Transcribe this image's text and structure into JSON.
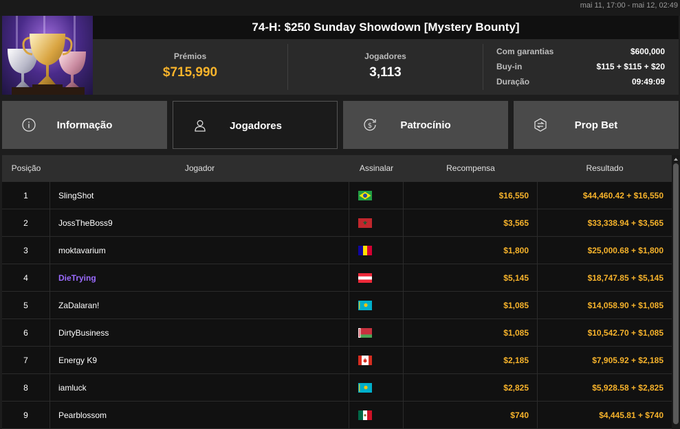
{
  "header": {
    "date_range": "mai 11, 17:00 - mai 12, 02:49",
    "title": "74-H: $250 Sunday Showdown [Mystery Bounty]"
  },
  "stats": {
    "prizes_label": "Prémios",
    "prizes_value": "$715,990",
    "players_label": "Jogadores",
    "players_value": "3,113",
    "details": [
      {
        "label": "Com garantias",
        "value": "$600,000"
      },
      {
        "label": "Buy-in",
        "value": "$115 + $115 + $20"
      },
      {
        "label": "Duração",
        "value": "09:49:09"
      }
    ]
  },
  "tabs": [
    {
      "label": "Informação",
      "icon": "info-icon",
      "active": false
    },
    {
      "label": "Jogadores",
      "icon": "user-icon",
      "active": true
    },
    {
      "label": "Patrocínio",
      "icon": "dollar-icon",
      "active": false
    },
    {
      "label": "Prop Bet",
      "icon": "prop-bet-icon",
      "active": false
    }
  ],
  "table": {
    "columns": [
      "Posição",
      "Jogador",
      "Assinalar",
      "Recompensa",
      "Resultado"
    ],
    "rows": [
      {
        "pos": "1",
        "player": "SlingShot",
        "flag": "brazil-flag",
        "bounty": "$16,550",
        "result": "$44,460.42 + $16,550",
        "highlight": false
      },
      {
        "pos": "2",
        "player": "JossTheBoss9",
        "flag": "morocco-flag",
        "bounty": "$3,565",
        "result": "$33,338.94 + $3,565",
        "highlight": false
      },
      {
        "pos": "3",
        "player": "moktavarium",
        "flag": "andorra-flag",
        "bounty": "$1,800",
        "result": "$25,000.68 + $1,800",
        "highlight": false
      },
      {
        "pos": "4",
        "player": "DieTrying",
        "flag": "austria-flag",
        "bounty": "$5,145",
        "result": "$18,747.85 + $5,145",
        "highlight": true
      },
      {
        "pos": "5",
        "player": "ZaDalaran!",
        "flag": "kazakhstan-flag",
        "bounty": "$1,085",
        "result": "$14,058.90 + $1,085",
        "highlight": false
      },
      {
        "pos": "6",
        "player": "DirtyBusiness",
        "flag": "belarus-flag",
        "bounty": "$1,085",
        "result": "$10,542.70 + $1,085",
        "highlight": false
      },
      {
        "pos": "7",
        "player": "Energy K9",
        "flag": "canada-flag",
        "bounty": "$2,185",
        "result": "$7,905.92 + $2,185",
        "highlight": false
      },
      {
        "pos": "8",
        "player": "iamluck",
        "flag": "kazakhstan-flag",
        "bounty": "$2,825",
        "result": "$5,928.58 + $2,825",
        "highlight": false
      },
      {
        "pos": "9",
        "player": "Pearblossom",
        "flag": "mexico-flag",
        "bounty": "$740",
        "result": "$4,445.81 + $740",
        "highlight": false
      }
    ]
  },
  "colors": {
    "accent_gold": "#f7b32b",
    "highlight_purple": "#9b6bff",
    "tab_inactive": "#4a4a4a",
    "tab_active": "#1b1b1b"
  }
}
